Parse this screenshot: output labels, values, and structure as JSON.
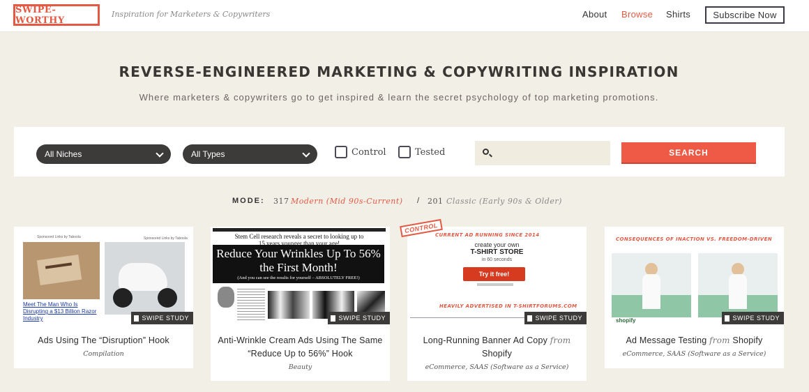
{
  "header": {
    "logo": "SWIPE-WORTHY",
    "tagline": "Inspiration for Marketers & Copywriters",
    "nav": [
      {
        "label": "About"
      },
      {
        "label": "Browse"
      },
      {
        "label": "Shirts"
      }
    ],
    "subscribe_label": "Subscribe Now"
  },
  "hero": {
    "title": "REVERSE-ENGINEERED MARKETING & COPYWRITING INSPIRATION",
    "subtitle": "Where marketers & copywriters go to get inspired & learn the secret psychology of top marketing promotions."
  },
  "filters": {
    "niches": "All Niches",
    "types": "All Types",
    "control_label": "Control",
    "tested_label": "Tested",
    "search_value": "",
    "search_button": "SEARCH"
  },
  "mode": {
    "label": "MODE:",
    "modern_count": "317",
    "modern_label": "Modern (Mid 90s-Current)",
    "separator": "/",
    "classic_count": "201",
    "classic_label": "Classic (Early 90s & Older)"
  },
  "colors": {
    "accent": "#e25a44",
    "dark": "#3d3a3a",
    "background": "#f2efe6"
  },
  "cards": [
    {
      "title": "Ads Using The “Disruption” Hook",
      "category": "Compilation",
      "badge": "SWIPE STUDY",
      "thumb": {
        "sponsor_left": "Sponsored Links by Taboola",
        "sponsor_right": "Sponsored Links by Taboola",
        "link_text": "Meet The Man Who Is Disrupting a $13 Billion Razor Industry"
      }
    },
    {
      "title": "Anti-Wrinkle Cream Ads Using The Same “Reduce Up to 56%” Hook",
      "category": "Beauty",
      "badge": "SWIPE STUDY",
      "thumb": {
        "lead": "Stem Cell research reveals a secret to looking up to 15 years younger than your age!",
        "headline": "Reduce Your Wrinkles Up To 56% the First Month!",
        "subline": "(And you can see the results for yourself – ABSOLUTELY FREE!)"
      }
    },
    {
      "title": "Long-Running Banner Ad Copy",
      "from": "from",
      "brand": "Shopify",
      "category": "eCommerce, SAAS (Software as a Service)",
      "badge": "SWIPE STUDY",
      "stamp": "CONTROL",
      "thumb": {
        "top": "CURRENT AD RUNNING SINCE 2014",
        "line1": "create your own",
        "line2": "T-SHIRT STORE",
        "line3": "in 60 seconds",
        "cta": "Try it free!",
        "bottom": "HEAVILY ADVERTISED IN T-SHIRTFORUMS.COM"
      }
    },
    {
      "title": "Ad Message Testing",
      "from": "from",
      "brand": "Shopify",
      "category": "eCommerce, SAAS (Software as a Service)",
      "badge": "SWIPE STUDY",
      "thumb": {
        "top": "CONSEQUENCES OF INACTION VS. FREEDOM-DRIVEN",
        "logo": "shopify"
      }
    }
  ]
}
